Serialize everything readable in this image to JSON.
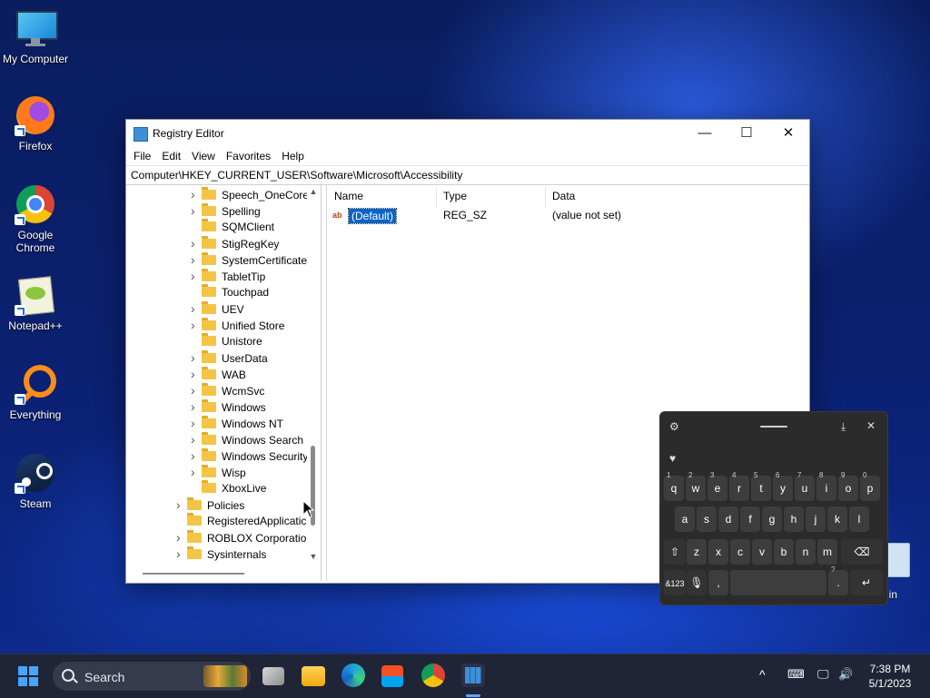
{
  "desktop": {
    "icons": [
      {
        "label": "My Computer",
        "icon": "computer-icon"
      },
      {
        "label": "Firefox",
        "icon": "firefox-icon"
      },
      {
        "label": "Google Chrome",
        "icon": "chrome-icon"
      },
      {
        "label": "Notepad++",
        "icon": "notepadpp-icon"
      },
      {
        "label": "Everything",
        "icon": "everything-search-icon"
      },
      {
        "label": "Steam",
        "icon": "steam-icon"
      }
    ],
    "recycle_bin_label": "le Bin"
  },
  "regedit": {
    "title": "Registry Editor",
    "controls": {
      "minimize": "—",
      "maximize": "☐",
      "close": "✕"
    },
    "menu": [
      "File",
      "Edit",
      "View",
      "Favorites",
      "Help"
    ],
    "address": "Computer\\HKEY_CURRENT_USER\\Software\\Microsoft\\Accessibility",
    "tree": [
      {
        "label": "Speech_OneCore",
        "expandable": true
      },
      {
        "label": "Spelling",
        "expandable": true
      },
      {
        "label": "SQMClient",
        "expandable": false
      },
      {
        "label": "StigRegKey",
        "expandable": true
      },
      {
        "label": "SystemCertificate",
        "expandable": true
      },
      {
        "label": "TabletTip",
        "expandable": true
      },
      {
        "label": "Touchpad",
        "expandable": false
      },
      {
        "label": "UEV",
        "expandable": true
      },
      {
        "label": "Unified Store",
        "expandable": true
      },
      {
        "label": "Unistore",
        "expandable": false
      },
      {
        "label": "UserData",
        "expandable": true
      },
      {
        "label": "WAB",
        "expandable": true
      },
      {
        "label": "WcmSvc",
        "expandable": true
      },
      {
        "label": "Windows",
        "expandable": true
      },
      {
        "label": "Windows NT",
        "expandable": true
      },
      {
        "label": "Windows Search",
        "expandable": true
      },
      {
        "label": "Windows Security",
        "expandable": true
      },
      {
        "label": "Wisp",
        "expandable": true
      },
      {
        "label": "XboxLive",
        "expandable": false
      },
      {
        "label": "Policies",
        "expandable": true
      },
      {
        "label": "RegisteredApplicatic",
        "expandable": false
      },
      {
        "label": "ROBLOX Corporation",
        "expandable": true
      },
      {
        "label": "Sysinternals",
        "expandable": true
      }
    ],
    "columns": {
      "name": "Name",
      "type": "Type",
      "data": "Data"
    },
    "values": [
      {
        "name": "(Default)",
        "type": "REG_SZ",
        "data": "(value not set)"
      }
    ]
  },
  "keyboard": {
    "row1": [
      {
        "k": "q",
        "s": "1"
      },
      {
        "k": "w",
        "s": "2"
      },
      {
        "k": "e",
        "s": "3"
      },
      {
        "k": "r",
        "s": "4"
      },
      {
        "k": "t",
        "s": "5"
      },
      {
        "k": "y",
        "s": "6"
      },
      {
        "k": "u",
        "s": "7"
      },
      {
        "k": "i",
        "s": "8"
      },
      {
        "k": "o",
        "s": "9"
      },
      {
        "k": "p",
        "s": "0"
      }
    ],
    "row2": [
      "a",
      "s",
      "d",
      "f",
      "g",
      "h",
      "j",
      "k",
      "l"
    ],
    "row3": [
      "z",
      "x",
      "c",
      "v",
      "b",
      "n",
      "m"
    ],
    "shift": "⇧",
    "backspace": "⌫",
    "symbols": "&123",
    "mic": "🎙",
    "comma": ",",
    "period": ".",
    "question_sup": "?",
    "enter": "↵"
  },
  "taskbar": {
    "search_label": "Search",
    "tray_chevron": "^",
    "time": "7:38 PM",
    "date": "5/1/2023"
  }
}
